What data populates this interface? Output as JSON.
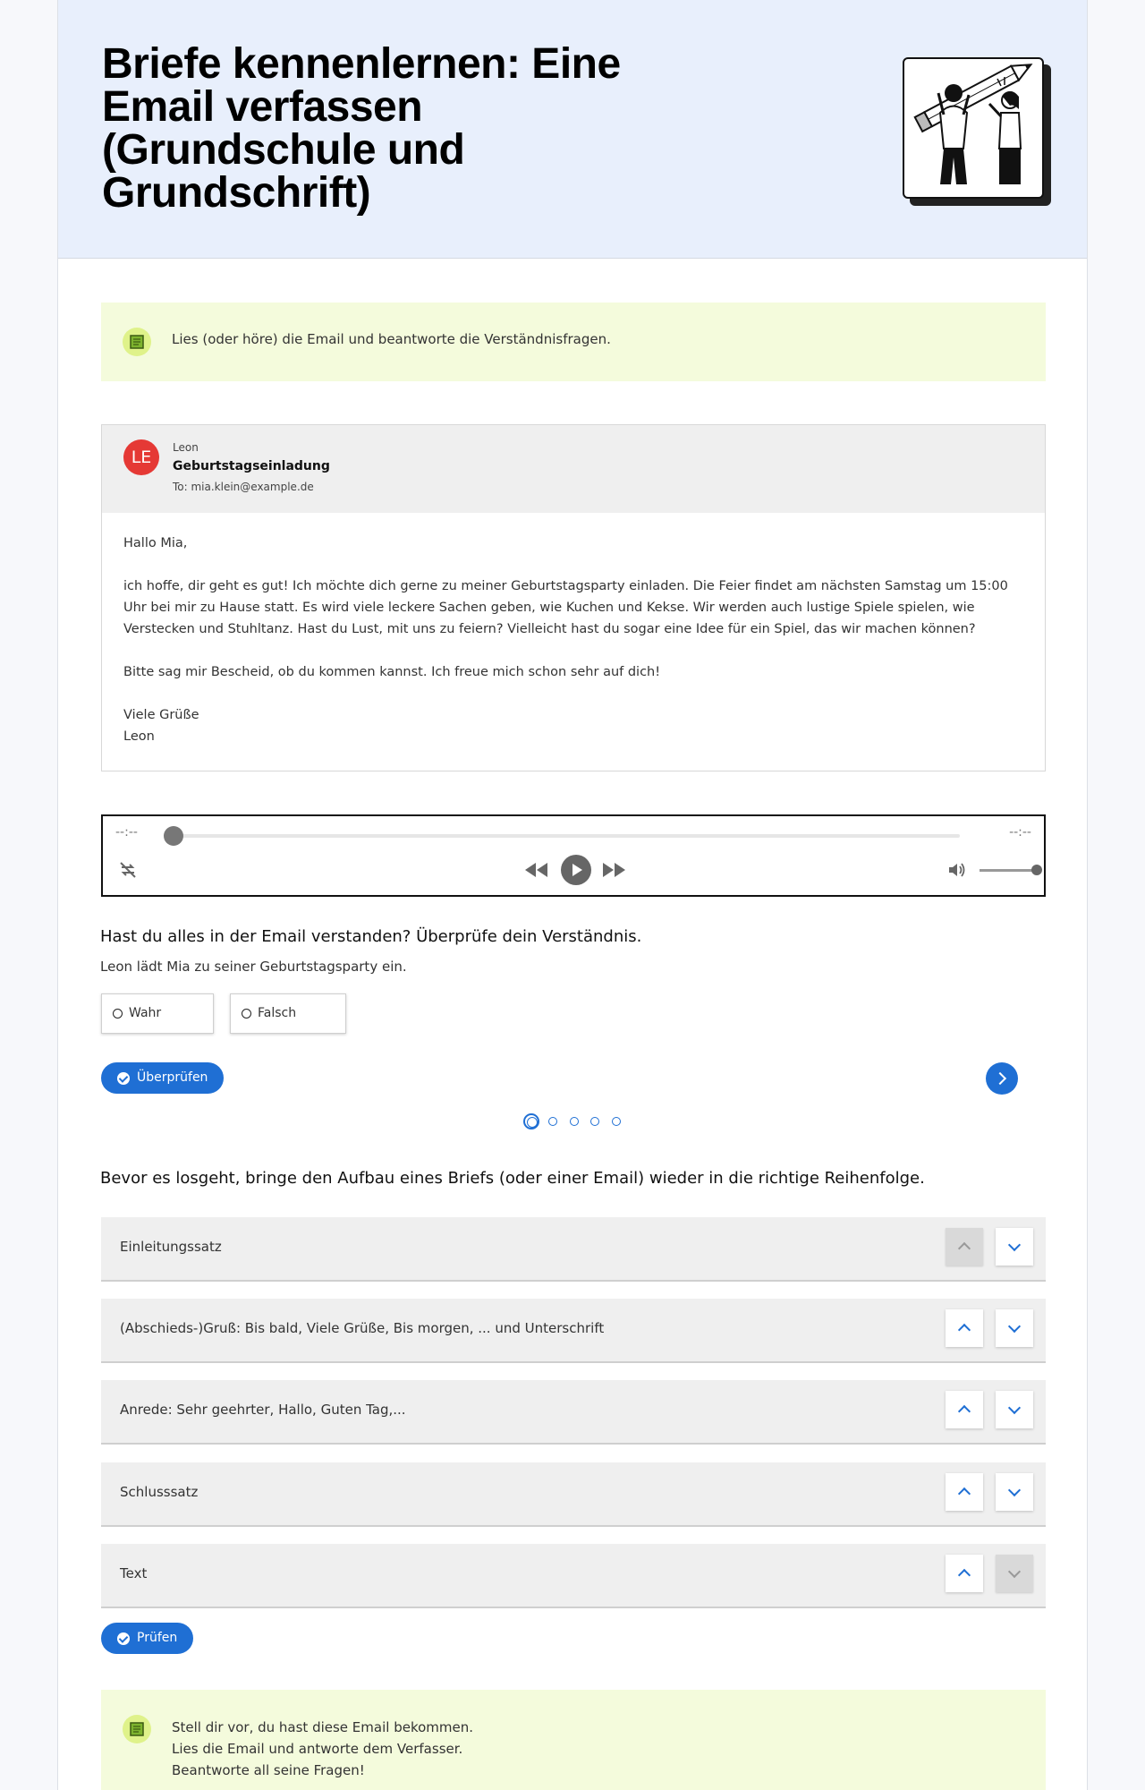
{
  "header": {
    "title": "Briefe kennenlernen: Eine Email verfassen (Grundschule und Grundschrift)",
    "illustration_icon": "two-people-holding-giant-pencil-illustration"
  },
  "instruction": {
    "icon": "notebook-icon",
    "text": "Lies (oder höre) die Email und beantworte die Verständnisfragen."
  },
  "email": {
    "avatar_initials": "LE",
    "avatar_color": "#e53935",
    "sender": "Leon",
    "subject": "Geburtstagseinladung",
    "to": "To: mia.klein@example.de",
    "greeting": "Hallo Mia,",
    "paragraph1": "ich hoffe, dir geht es gut! Ich möchte dich gerne zu meiner Geburtstagsparty einladen. Die Feier findet am nächsten Samstag um 15:00 Uhr bei mir zu Hause statt. Es wird viele leckere Sachen geben, wie Kuchen und Kekse. Wir werden auch lustige Spiele spielen, wie Verstecken und Stuhltanz. Hast du Lust, mit uns zu feiern? Vielleicht hast du sogar eine Idee für ein Spiel, das wir machen können?",
    "paragraph2": "Bitte sag mir Bescheid, ob du kommen kannst. Ich freue mich schon sehr auf dich!",
    "closing": "Viele Grüße",
    "signature": "Leon"
  },
  "audio": {
    "current_time": "--:--",
    "duration": "--:--",
    "progress": 0,
    "volume": 1.0
  },
  "quiz": {
    "heading": "Hast du alles in der Email verstanden? Überprüfe dein Verständnis.",
    "statement": "Leon lädt Mia zu seiner Geburtstagsparty ein.",
    "options": [
      "Wahr",
      "Falsch"
    ],
    "check_label": "Überprüfen",
    "total_questions": 5,
    "current_question": 1
  },
  "sorting": {
    "heading": "Bevor es losgeht, bringe den Aufbau eines Briefs (oder einer Email) wieder in die richtige Reihenfolge.",
    "items": [
      "Einleitungssatz",
      "(Abschieds-)Gruß: Bis bald, Viele Grüße, Bis morgen, ... und Unterschrift",
      "Anrede: Sehr geehrter, Hallo, Guten Tag,...",
      "Schlusssatz",
      "Text"
    ],
    "check_label": "Prüfen"
  },
  "bottom_note": {
    "lines": [
      "Stell dir vor, du hast diese Email bekommen.",
      "Lies die Email und antworte dem Verfasser.",
      "Beantworte all seine Fragen!"
    ]
  },
  "colors": {
    "accent": "#1f6fd4",
    "header_bg": "#e8effc",
    "note_bg": "#f4fbdc"
  }
}
